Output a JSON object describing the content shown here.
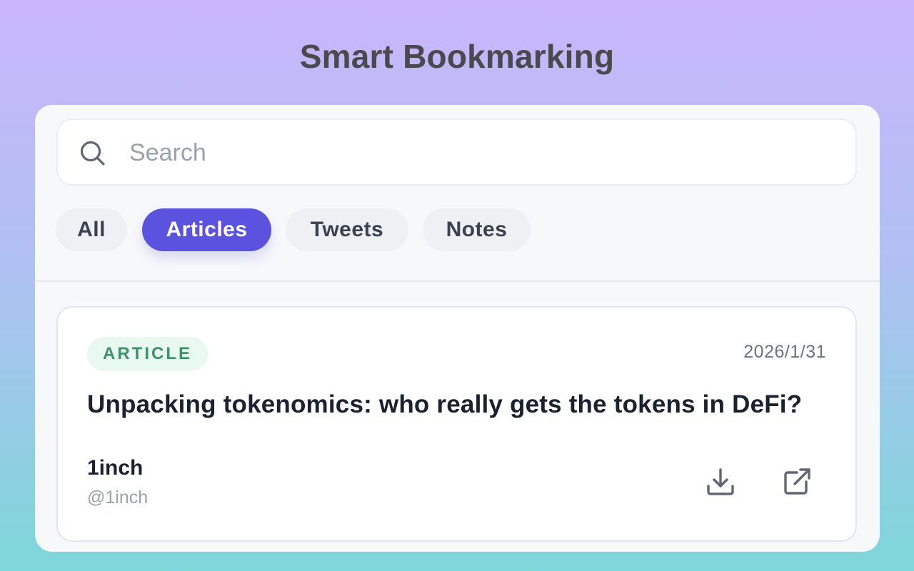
{
  "app": {
    "title": "Smart Bookmarking"
  },
  "search": {
    "placeholder": "Search",
    "value": "",
    "icon": "search-icon"
  },
  "filters": [
    {
      "label": "All",
      "active": false
    },
    {
      "label": "Articles",
      "active": true
    },
    {
      "label": "Tweets",
      "active": false
    },
    {
      "label": "Notes",
      "active": false
    }
  ],
  "bookmarks": [
    {
      "type_badge": "ARTICLE",
      "date": "2026/1/31",
      "title": "Unpacking tokenomics: who really gets the tokens in DeFi?",
      "author": {
        "name": "1inch",
        "handle": "@1inch"
      },
      "actions": [
        {
          "icon": "download-icon"
        },
        {
          "icon": "external-link-icon"
        }
      ]
    }
  ],
  "colors": {
    "accent": "#5b52e0",
    "badge_bg": "#e9f8f0",
    "badge_text": "#3e9366",
    "background_top": "#c9b6fb",
    "background_bottom": "#7ed7d9"
  }
}
